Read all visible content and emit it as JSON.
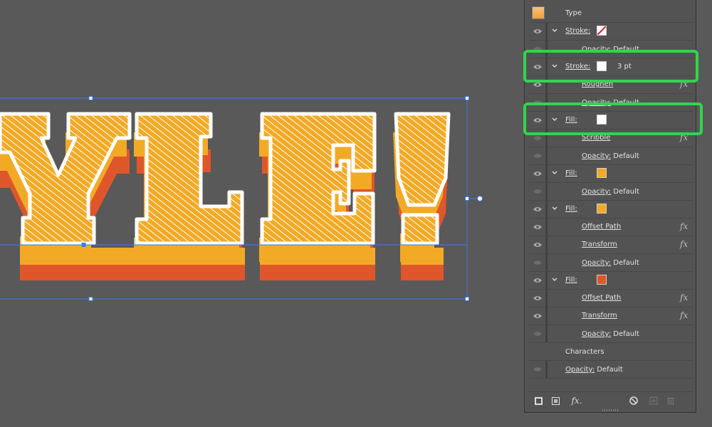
{
  "canvas": {
    "visible_text": "YLE!",
    "colors": {
      "canvas_bg": "#595959",
      "face": "#f2aa26",
      "extrude_orange": "#f2aa26",
      "extrude_red": "#e0562b",
      "stroke": "#ffffff",
      "selection": "#3e7be8"
    }
  },
  "appearance_panel": {
    "header_label": "Type",
    "rows": [
      {
        "name": "stroke-row-1",
        "label": "Stroke:",
        "swatch": "none"
      },
      {
        "name": "opacity-row-1",
        "label": "Opacity:",
        "value": "Default"
      },
      {
        "name": "stroke-row-2",
        "label": "Stroke:",
        "swatch": "#ffffff",
        "value": "3 pt"
      },
      {
        "name": "roughen-row",
        "label": "Roughen",
        "fx": "fx"
      },
      {
        "name": "opacity-row-2",
        "label": "Opacity:",
        "value": "Default"
      },
      {
        "name": "fill-row-1",
        "label": "Fill:",
        "swatch": "#ffffff"
      },
      {
        "name": "scribble-row",
        "label": "Scribble",
        "fx": "fx"
      },
      {
        "name": "opacity-row-3",
        "label": "Opacity:",
        "value": "Default"
      },
      {
        "name": "fill-row-2",
        "label": "Fill:",
        "swatch": "#f2aa26"
      },
      {
        "name": "opacity-row-4",
        "label": "Opacity:",
        "value": "Default"
      },
      {
        "name": "fill-row-3",
        "label": "Fill:",
        "swatch": "#f2aa26"
      },
      {
        "name": "offset-path-row-1",
        "label": "Offset Path",
        "fx": "fx"
      },
      {
        "name": "transform-row-1",
        "label": "Transform",
        "fx": "fx"
      },
      {
        "name": "opacity-row-5",
        "label": "Opacity:",
        "value": "Default"
      },
      {
        "name": "fill-row-4",
        "label": "Fill:",
        "swatch": "#e0562b"
      },
      {
        "name": "offset-path-row-2",
        "label": "Offset Path",
        "fx": "fx"
      },
      {
        "name": "transform-row-2",
        "label": "Transform",
        "fx": "fx"
      },
      {
        "name": "opacity-row-6",
        "label": "Opacity:",
        "value": "Default"
      },
      {
        "name": "characters-row",
        "label": "Characters"
      },
      {
        "name": "opacity-row-7",
        "label": "Opacity:",
        "value": "Default"
      }
    ],
    "bottom_icons": [
      "new-stroke-icon",
      "new-fill-icon",
      "add-effect-icon",
      "clear-appearance-icon",
      "duplicate-item-icon",
      "delete-item-icon"
    ],
    "add_effect_label": "fx.",
    "highlight_color": "#2fd64b"
  }
}
